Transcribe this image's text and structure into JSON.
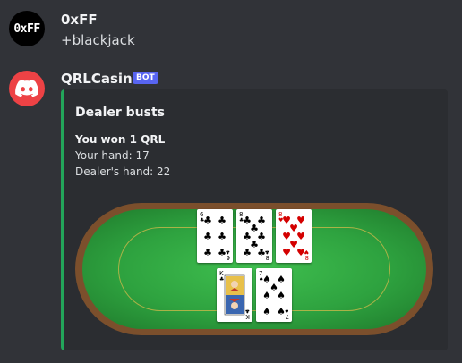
{
  "messages": [
    {
      "author": "0xFF",
      "avatar_text": "0xFF",
      "content": "+blackjack"
    },
    {
      "author": "QRLCasino",
      "tag": "BOT",
      "embed": {
        "accent_color": "#23a55a",
        "title": "Dealer busts",
        "result": "You won 1 QRL",
        "your_hand": "Your hand: 17",
        "dealer_hand": "Dealer's hand: 22",
        "table": {
          "dealer_cards": [
            {
              "rank": "6",
              "suit": "clubs"
            },
            {
              "rank": "8",
              "suit": "clubs"
            },
            {
              "rank": "8",
              "suit": "hearts"
            }
          ],
          "player_cards": [
            {
              "rank": "K",
              "suit": "clubs"
            },
            {
              "rank": "7",
              "suit": "spades"
            }
          ]
        }
      }
    }
  ],
  "colors": {
    "background": "#313338",
    "embed_bg": "#2b2d31",
    "bot_tag": "#5865f2",
    "bot_avatar": "#ed4245",
    "felt": "#2ea23f",
    "rail": "#7b4f2c"
  }
}
